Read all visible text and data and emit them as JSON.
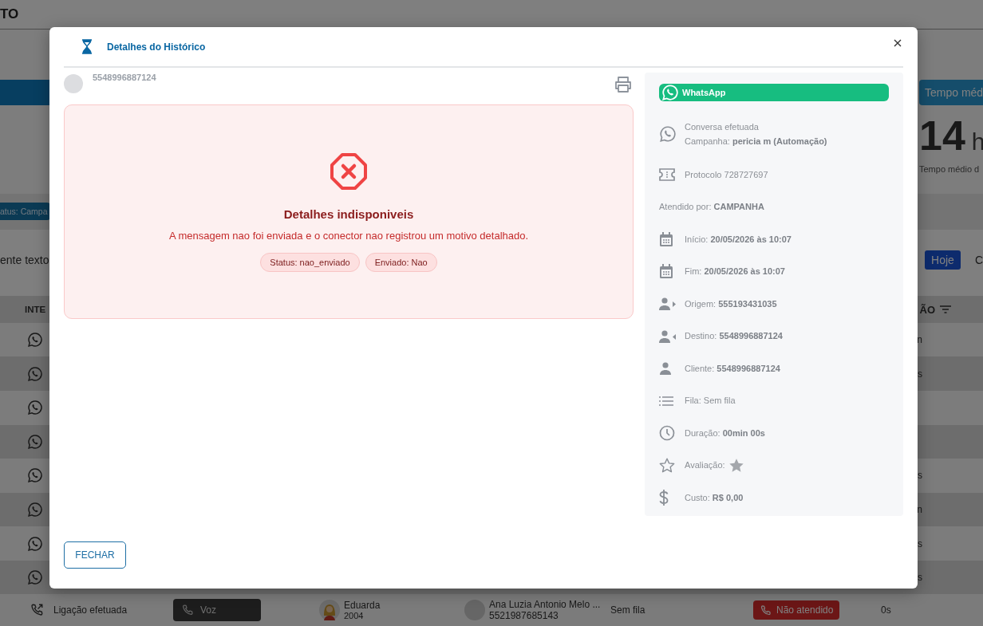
{
  "background": {
    "brand": "TO",
    "stat_button": "Tempo méd",
    "stat_value": "14",
    "stat_unit": "h",
    "stat_caption": "Tempo médio d",
    "filter_chip": "atus: Campa",
    "search_text": "ente texto",
    "today_button": "Hoje",
    "period_option": "C",
    "header_left": "INTE",
    "header_right": "ÃO",
    "rows": [
      {
        "kind": "whatsapp",
        "last_cell": "n"
      },
      {
        "kind": "whatsapp",
        "last_cell": "s"
      },
      {
        "kind": "whatsapp"
      },
      {
        "kind": "whatsapp"
      },
      {
        "kind": "whatsapp",
        "last_cell": "s"
      },
      {
        "kind": "whatsapp",
        "last_cell": "n"
      },
      {
        "kind": "whatsapp",
        "last_cell": "s"
      },
      {
        "kind": "whatsapp",
        "last_cell": "s"
      }
    ],
    "call_row": {
      "kind": "call",
      "type": "Ligação efetuada",
      "channel": "Voz",
      "agent_name": "Eduarda",
      "agent_ext": "2004",
      "client_name": "Ana Luzia Antonio Melo ...",
      "client_phone": "5521987685143",
      "queue": "Sem fila",
      "status": "Não atendido",
      "duration": "0s"
    }
  },
  "modal": {
    "title": "Detalhes do Histórico",
    "contact": "5548996887124",
    "error": {
      "title": "Detalhes indisponiveis",
      "message": "A mensagem nao foi enviada e o conector nao registrou um motivo detalhado.",
      "tags": [
        "Status: nao_enviado",
        "Enviado: Nao"
      ]
    },
    "channel": "WhatsApp",
    "details": [
      {
        "kind": "conversation",
        "lines": [
          "Conversa efetuada",
          "Campanha: **pericia m (Automação)**"
        ]
      },
      {
        "kind": "protocol",
        "lines": [
          "Protocolo 728727697"
        ]
      },
      {
        "kind": "plain",
        "lines": [
          "Atendido por: **CAMPANHA**"
        ]
      },
      {
        "kind": "start",
        "lines": [
          "Início: **20/05/2026 às 10:07**"
        ]
      },
      {
        "kind": "end",
        "lines": [
          "Fim: **20/05/2026 às 10:07**"
        ]
      },
      {
        "kind": "origin",
        "lines": [
          "Origem: **555193431035**"
        ]
      },
      {
        "kind": "destination",
        "lines": [
          "Destino: **5548996887124**"
        ]
      },
      {
        "kind": "client",
        "lines": [
          "Cliente: **5548996887124**"
        ]
      },
      {
        "kind": "queue",
        "lines": [
          "Fila: Sem fila"
        ]
      },
      {
        "kind": "duration",
        "lines": [
          "Duração: **00min 00s**"
        ]
      },
      {
        "kind": "rating",
        "lines": [
          "Avaliação:"
        ]
      },
      {
        "kind": "cost",
        "lines": [
          "Custo: **R$ 0,00**"
        ]
      }
    ],
    "close_button": "FECHAR"
  }
}
